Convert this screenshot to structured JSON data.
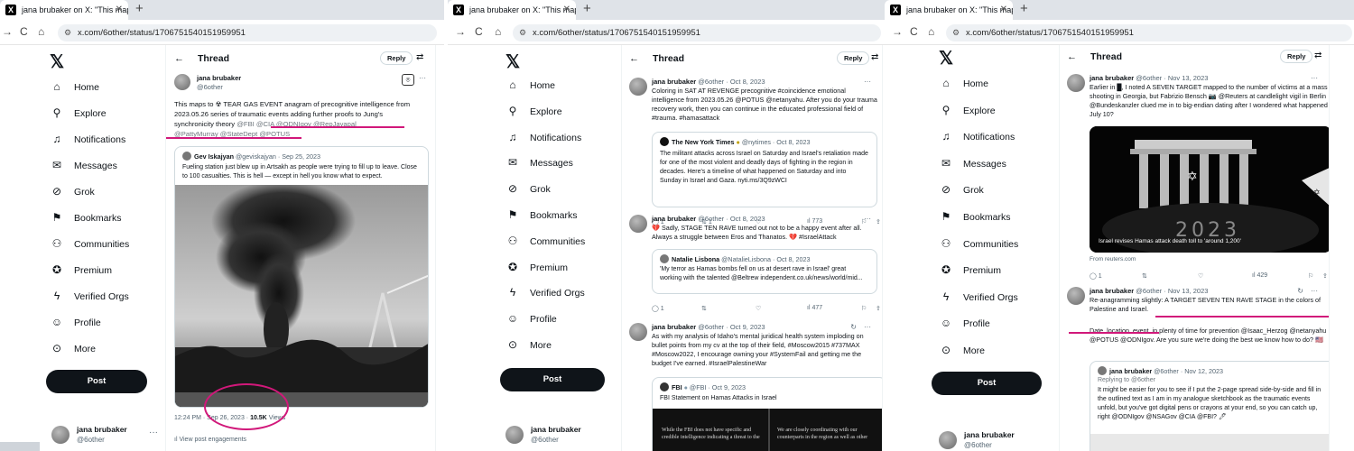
{
  "browser": {
    "tab_title": "jana brubaker on X: \"This maps",
    "url": "x.com/6other/status/1706751540151959951"
  },
  "sidebar": {
    "items": [
      {
        "label": "Home",
        "icon": "home-icon",
        "glyph": "⌂"
      },
      {
        "label": "Explore",
        "icon": "search-icon",
        "glyph": "⚲"
      },
      {
        "label": "Notifications",
        "icon": "bell-icon",
        "glyph": "♫"
      },
      {
        "label": "Messages",
        "icon": "mail-icon",
        "glyph": "✉"
      },
      {
        "label": "Grok",
        "icon": "grok-icon",
        "glyph": "⊘"
      },
      {
        "label": "Bookmarks",
        "icon": "bookmark-icon",
        "glyph": "⚑"
      },
      {
        "label": "Communities",
        "icon": "communities-icon",
        "glyph": "⚇"
      },
      {
        "label": "Premium",
        "icon": "premium-icon",
        "glyph": "✪"
      },
      {
        "label": "Verified Orgs",
        "icon": "lightning-icon",
        "glyph": "ϟ"
      },
      {
        "label": "Profile",
        "icon": "person-icon",
        "glyph": "☺"
      },
      {
        "label": "More",
        "icon": "more-circle-icon",
        "glyph": "⊙"
      }
    ],
    "post_label": "Post",
    "user_name": "jana brubaker",
    "user_handle": "@6other"
  },
  "thread": {
    "title": "Thread",
    "reply_label": "Reply"
  },
  "panel1": {
    "author": "jana brubaker",
    "handle": "@6other",
    "text_a": "This maps to ☢ TEAR GAS EVENT anagram of precognitive intelligence from 2023.05.26 series of traumatic events adding further proofs to Jung's synchronicity theory ",
    "mentions_a": "@FBI @CIA @ODNIgov @RepJayapal",
    "mentions_b": "@PattyMurray @StateDept @POTUS",
    "quote_author": "Gev Iskajyan",
    "quote_meta": "@geviskajyan · Sep 25, 2023",
    "quote_text": "Fueling station just blew up in Artsakh as people were trying to fill up to leave. Close to 100 casualties. This is hell — except in hell you know what to expect.",
    "time": "12:24 PM · Sep 26, 2023 · ",
    "views": "10.5K",
    "views_label": " Views",
    "engagements": "View post engagements"
  },
  "panel2": {
    "posts": [
      {
        "author": "jana brubaker",
        "meta": "@6other · Oct 8, 2023",
        "text": "Coloring in SAT AT REVENGE precognitive #coincidence emotional intelligence from 2023.05.26 @POTUS @netanyahu. After you do your trauma recovery work, then you can continue in the educated professional field of #trauma. #hamasattack",
        "quote_author": "The New York Times",
        "quote_meta": "@nytimes · Oct 8, 2023",
        "quote_text": "The militant attacks across Israel on Saturday and Israel's retaliation made for one of the most violent and deadly days of fighting in the region in decades. Here's a timeline of what happened on Saturday and into Sunday in Israel and Gaza. nyti.ms/3Q9zWCI",
        "replies": "1",
        "reposts": "1",
        "views": "773"
      },
      {
        "author": "jana brubaker",
        "meta": "@6other · Oct 8, 2023",
        "text": "💔 Sadly, STAGE TEN RAVE turned out not to be a happy event after all. Always a struggle between Eros and Thanatos. 💔 #IsraelAttack",
        "quote_author": "Natalie Lisbona",
        "quote_meta": "@NatalieLisbona · Oct 8, 2023",
        "quote_text": "'My terror as Hamas bombs fell on us at desert rave in Israel' great working with the talented @Beltrew independent.co.uk/news/world/mid...",
        "replies": "1",
        "views": "477"
      },
      {
        "author": "jana brubaker",
        "meta": "@6other · Oct 9, 2023",
        "text": "As with my analysis of Idaho's mental juridical health system imploding on bullet points from my cv at the top of their field, #Moscow2015 #737MAX #Moscow2022, I encourage owning your #SystemFail and getting me the budget I've earned. #IsraelPalestineWar",
        "quote_author": "FBI",
        "quote_meta": "@FBI · Oct 9, 2023",
        "quote_text": "FBI Statement on Hamas Attacks in Israel",
        "doc_left": "While the FBI does not have specific and credible intelligence indicating a threat to the",
        "doc_right": "We are closely coordinating with our counterparts in the region as well as other"
      }
    ]
  },
  "panel3": {
    "post1": {
      "author": "jana brubaker",
      "meta": "@6other · Nov 13, 2023",
      "text": "Earlier in █, I noted A SEVEN TARGET mapped to the number of victims at a mass shooting in Georgia, but Fabrizio Bensch 📷 @Reuters at candlelight vigil in Berlin @Bundeskanzler clued me in to big-endian dating after I wondered what happened July 10?",
      "photo_year": "2023",
      "photo_caption": "Israel revises Hamas attack death toll to 'around 1,200'",
      "source": "From reuters.com",
      "replies": "1",
      "views": "429"
    },
    "post2": {
      "author": "jana brubaker",
      "meta": "@6other · Nov 13, 2023",
      "text_a": "Re-anagramming slightly: A TARGET SEVEN TEN RAVE STAGE in the colors of Palestine and Israel.",
      "text_b": "Date, location, event, in plenty of time for prevention @Isaac_Herzog @netanyahu @POTUS @ODNIgov. Are you sure we're doing the best we know how to do? 🇺🇸"
    },
    "quote": {
      "author": "jana brubaker",
      "meta": "@6other · Nov 12, 2023",
      "replying": "Replying to @6other",
      "text": "It might be easier for you to see if I put the 2-page spread side-by-side and fill in the outlined text as I am in my analogue sketchbook as the traumatic events unfold, but you've got digital pens or crayons at your end, so you can catch up, right @ODNIgov @NSAGov @CIA @FBI? 🖊"
    }
  },
  "colors": {
    "annotation": "#d1187a",
    "link": "#1d9bf0"
  }
}
